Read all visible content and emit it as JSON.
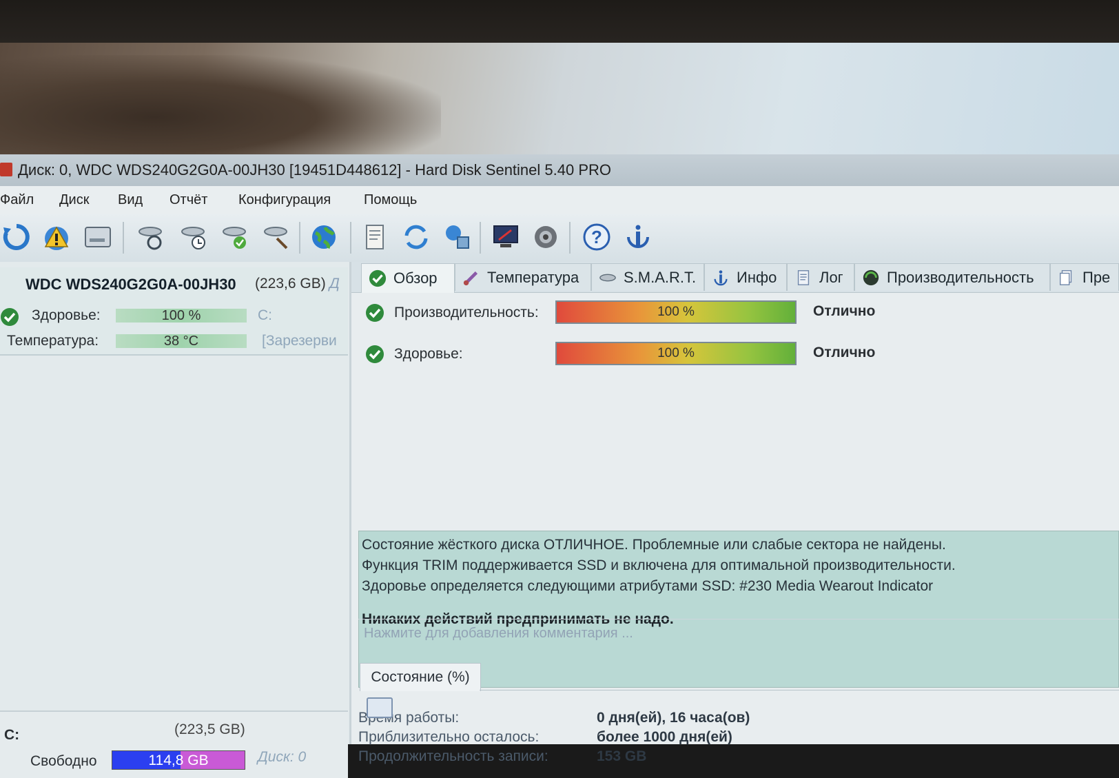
{
  "window": {
    "title_main": "Диск: 0, WDC WDS240G2G0A-00JH30 [19451D448612]",
    "title_app": "-  Hard Disk Sentinel 5.40 PRO"
  },
  "menu": [
    "Файл",
    "Диск",
    "Вид",
    "Отчёт",
    "Конфигурация",
    "Помощь"
  ],
  "toolbar": {
    "icons": [
      "refresh-icon",
      "alert-icon",
      "disk-icon",
      "disk-refresh-icon",
      "disk-time-icon",
      "disk-check-icon",
      "disk-tool-icon",
      "globe-icon",
      "report-icon",
      "sync-icon",
      "network-icon",
      "monitor-icon",
      "sound-icon",
      "help-icon",
      "info-icon"
    ]
  },
  "left": {
    "disk_name": "WDC WDS240G2G0A-00JH30",
    "disk_size": "(223,6 GB)",
    "disk_trunc": "Д",
    "health_label": "Здоровье:",
    "health_value": "100 %",
    "health_drive": "C:",
    "temp_label": "Температура:",
    "temp_value": "38 °C",
    "temp_note": "[Зарезерви",
    "volume": {
      "letter": "C:",
      "size": "(223,5 GB)",
      "free_label": "Свободно",
      "free_value": "114,8 GB",
      "free_fraction": 0.514,
      "disk_ref": "Диск: 0"
    }
  },
  "tabs": [
    {
      "label": "Обзор",
      "icon": "check-icon",
      "active": true
    },
    {
      "label": "Температура",
      "icon": "thermometer-icon",
      "active": false
    },
    {
      "label": "S.M.A.R.T.",
      "icon": "smart-icon",
      "active": false
    },
    {
      "label": "Инфо",
      "icon": "info-icon",
      "active": false
    },
    {
      "label": "Лог",
      "icon": "log-icon",
      "active": false
    },
    {
      "label": "Производительность",
      "icon": "performance-icon",
      "active": false
    },
    {
      "label": "Пре",
      "icon": "copy-icon",
      "active": false
    }
  ],
  "overview": {
    "performance_label": "Производительность:",
    "performance_value": "100 %",
    "performance_state": "Отлично",
    "health_label": "Здоровье:",
    "health_value": "100 %",
    "health_state": "Отлично",
    "status_lines": [
      "Состояние жёсткого диска ОТЛИЧНОЕ. Проблемные или слабые сектора не найдены.",
      "Функция TRIM поддерживается SSD и включена для оптимальной производительности.",
      "Здоровье определяется следующими атрибутами SSD: #230 Media Wearout Indicator"
    ],
    "status_action": "Никаких действий предпринимать не надо.",
    "uptime_label": "Время работы:",
    "uptime_value": "0 дня(ей), 16 часа(ов)",
    "remaining_label": "Приблизительно осталось:",
    "remaining_value": "более 1000 дня(ей)",
    "written_label": "Продолжительность записи:",
    "written_value": "153 GB",
    "comment_placeholder": "Нажмите для добавления комментария ...",
    "state_tab": "Состояние (%)"
  }
}
